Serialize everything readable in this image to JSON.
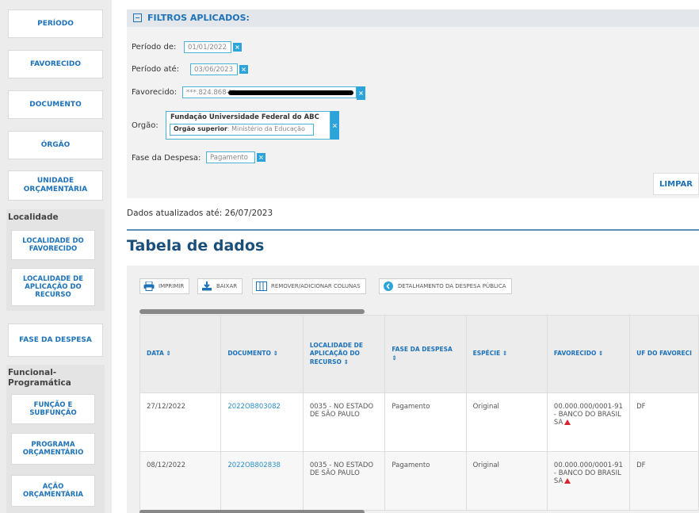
{
  "sidebar": {
    "items": [
      {
        "label": "PERÍODO"
      },
      {
        "label": "FAVORECIDO"
      },
      {
        "label": "DOCUMENTO"
      },
      {
        "label": "ÓRGÃO"
      },
      {
        "label": "UNIDADE ORÇAMENTÁRIA"
      }
    ],
    "localidade": {
      "title": "Localidade",
      "items": [
        {
          "label": "LOCALIDADE DO FAVORECIDO"
        },
        {
          "label": "LOCALIDADE DE APLICAÇÃO DO RECURSO"
        }
      ]
    },
    "fase_despesa": {
      "label": "FASE DA DESPESA"
    },
    "funcional": {
      "title": "Funcional-Programática",
      "items": [
        {
          "label": "FUNÇÃO E SUBFUNÇÃO"
        },
        {
          "label": "PROGRAMA ORÇAMENTÁRIO"
        },
        {
          "label": "AÇÃO ORÇAMENTÁRIA"
        }
      ]
    }
  },
  "filters": {
    "title": "FILTROS APLICADOS:",
    "periodo_de": {
      "label": "Período de:",
      "value": "01/01/2022"
    },
    "periodo_ate": {
      "label": "Período até:",
      "value": "03/06/2023"
    },
    "favorecido": {
      "label": "Favorecido:",
      "value": "***.824.868-** -"
    },
    "orgao": {
      "label": "Orgão:",
      "title": "Fundação Universidade Federal do ABC",
      "superior_label": "Orgão superior",
      "superior_value": ": Ministério da Educação"
    },
    "fase": {
      "label": "Fase da Despesa:",
      "value": "Pagamento"
    },
    "remove_symbol": "×",
    "clear_label": "LIMPAR"
  },
  "updated": {
    "label": "Dados atualizados até:",
    "date": "26/07/2023"
  },
  "section_title": "Tabela de dados",
  "toolbar": {
    "print": "IMPRIMIR",
    "download": "BAIXAR",
    "columns": "REMOVER/ADICIONAR COLUNAS",
    "detail": "DETALHAMENTO DA DESPESA PÚBLICA"
  },
  "table": {
    "columns": [
      "DATA ⇕",
      "DOCUMENTO ⇕",
      "LOCALIDADE DE APLICAÇÃO DO RECURSO ⇕",
      "FASE DA DESPESA ⇕",
      "ESPÉCIE ⇕",
      "FAVORECIDO ⇕",
      "UF DO FAVORECI"
    ],
    "rows": [
      {
        "data": "27/12/2022",
        "documento": "2022OB803082",
        "localidade": "0035 - NO ESTADO DE SÃO PAULO",
        "fase": "Pagamento",
        "especie": "Original",
        "favorecido": "00.000.000/0001-91 - BANCO DO BRASIL SA",
        "uf": "DF"
      },
      {
        "data": "08/12/2022",
        "documento": "2022OB802838",
        "localidade": "0035 - NO ESTADO DE SÃO PAULO",
        "fase": "Pagamento",
        "especie": "Original",
        "favorecido": "00.000.000/0001-91 - BANCO DO BRASIL SA",
        "uf": "DF"
      }
    ]
  },
  "colors": {
    "accent": "#1d72b8",
    "chip_border": "#49b3d6",
    "chip_x": "#2ca4d9",
    "title": "#1b4f7a",
    "warning": "#d9232d"
  }
}
